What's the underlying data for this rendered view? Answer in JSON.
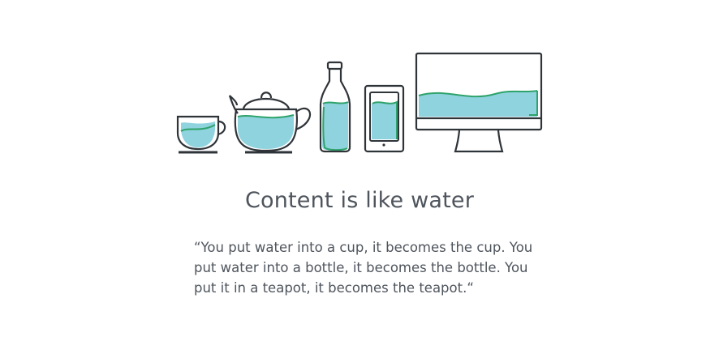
{
  "illustration": {
    "items": [
      "cup-icon",
      "teapot-icon",
      "bottle-icon",
      "phone-icon",
      "monitor-icon"
    ],
    "colors": {
      "outline": "#2f3439",
      "water": "#8fd3df",
      "wave": "#2fa36b"
    }
  },
  "heading": {
    "title": "Content is like water"
  },
  "quote": {
    "lines": [
      "“You put water into a cup, it becomes the cup. You",
      "put water into a bottle, it becomes the bottle. You",
      "put it in a teapot, it becomes the teapot.“"
    ]
  }
}
